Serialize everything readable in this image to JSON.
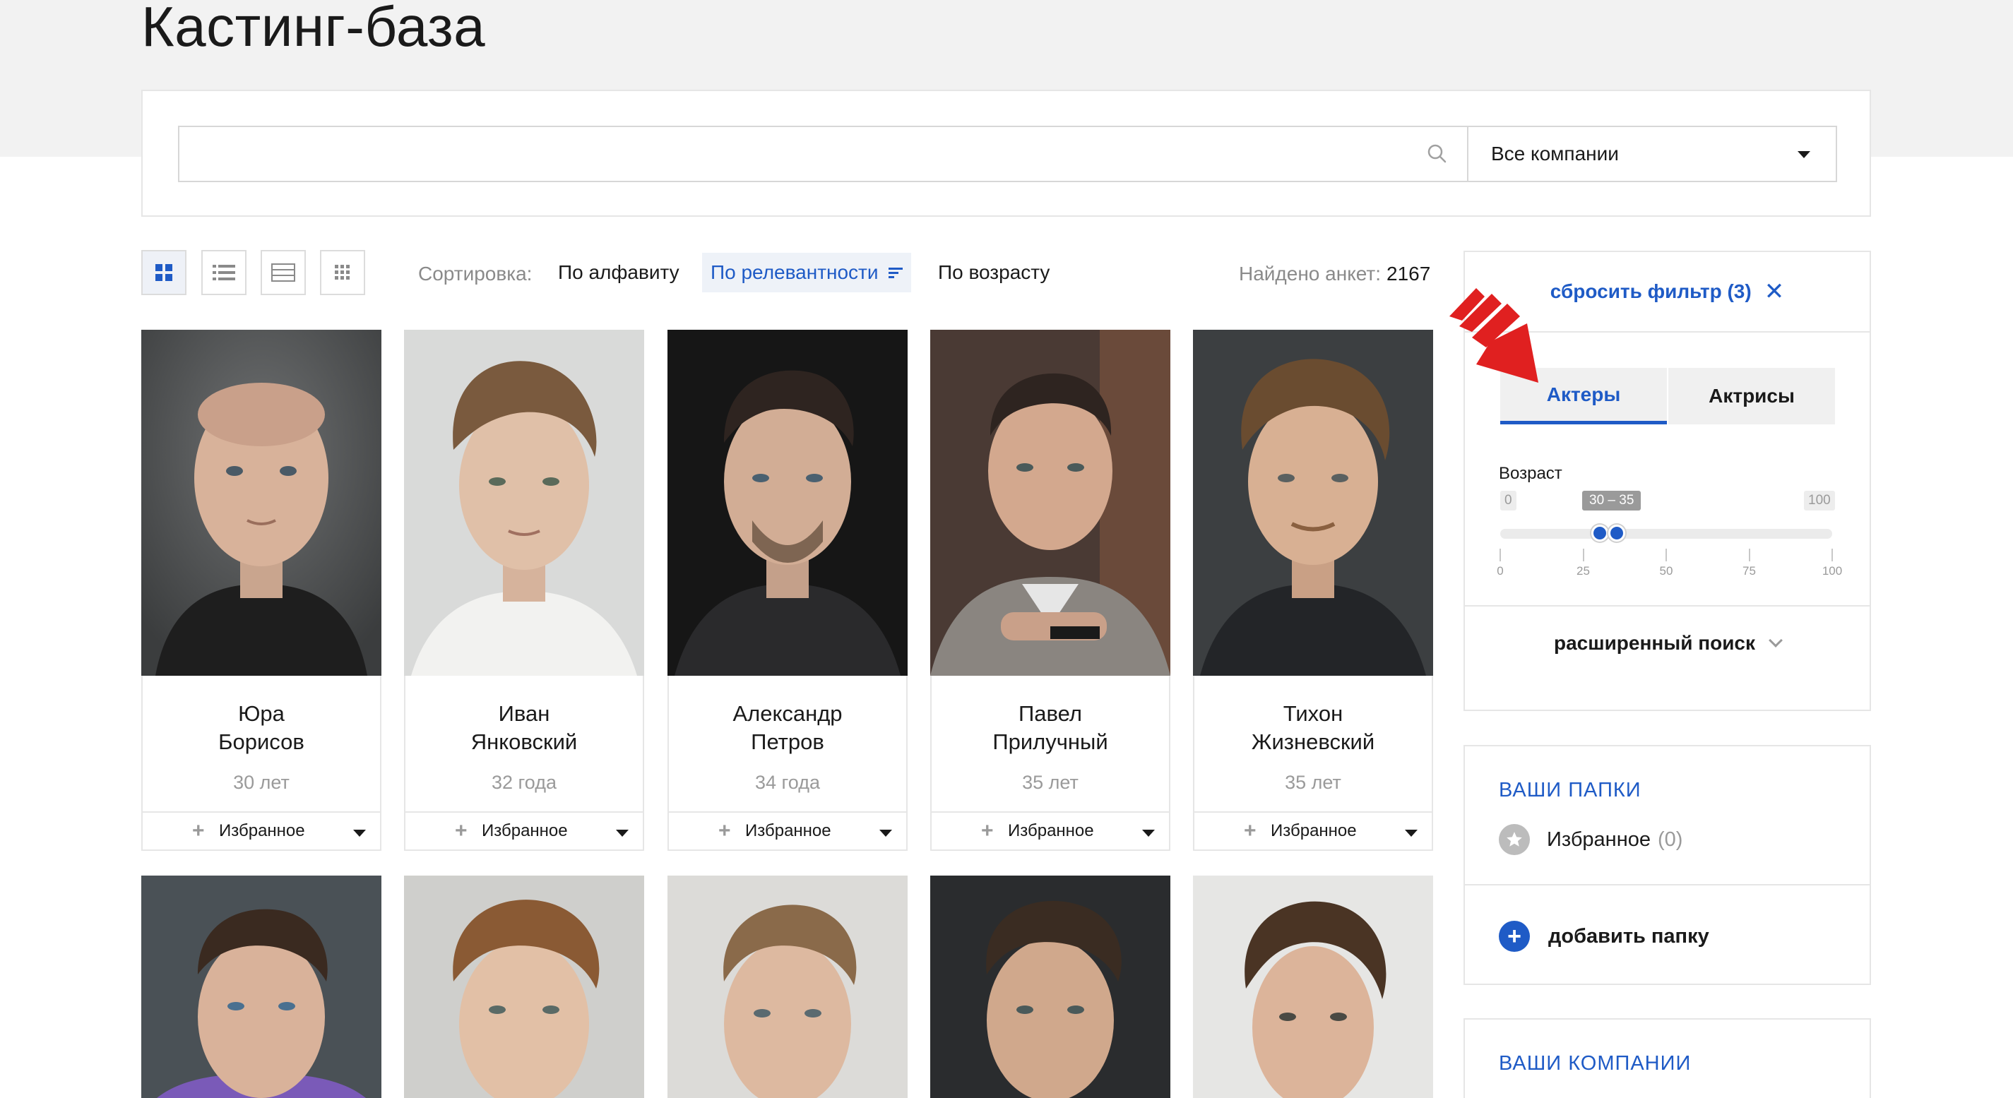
{
  "page": {
    "title": "Кастинг-база"
  },
  "search": {
    "value": "",
    "placeholder": "",
    "company_select": "Все компании"
  },
  "toolbar": {
    "sort_label": "Сортировка:",
    "sort_options": [
      "По алфавиту",
      "По релевантности",
      "По возрасту"
    ],
    "active_sort": "По релевантности",
    "found_label": "Найдено анкет:",
    "found_count": "2167"
  },
  "cards": [
    {
      "first": "Юра",
      "last": "Борисов",
      "age": "30 лет",
      "fav": "Избранное"
    },
    {
      "first": "Иван",
      "last": "Янковский",
      "age": "32 года",
      "fav": "Избранное"
    },
    {
      "first": "Александр",
      "last": "Петров",
      "age": "34 года",
      "fav": "Избранное"
    },
    {
      "first": "Павел",
      "last": "Прилучный",
      "age": "35 лет",
      "fav": "Избранное"
    },
    {
      "first": "Тихон",
      "last": "Жизневский",
      "age": "35 лет",
      "fav": "Избранное"
    }
  ],
  "filter": {
    "reset_label": "сбросить фильтр (3)",
    "tabs": [
      "Актеры",
      "Актрисы"
    ],
    "active_tab": "Актеры",
    "age_title": "Возраст",
    "age_min_label": "0",
    "age_max_label": "100",
    "age_range_label": "30 – 35",
    "age_from": 30,
    "age_to": 35,
    "scale_min": 0,
    "scale_max": 100,
    "ticks": [
      "0",
      "25",
      "50",
      "75",
      "100"
    ],
    "advanced": "расширенный поиск"
  },
  "folders": {
    "title": "ВАШИ ПАПКИ",
    "favorites_label": "Избранное",
    "favorites_count": "(0)",
    "add_label": "добавить папку"
  },
  "companies": {
    "title": "ВАШИ КОМПАНИИ"
  },
  "colors": {
    "accent": "#1f5bc6",
    "annotation": "#e02020"
  }
}
